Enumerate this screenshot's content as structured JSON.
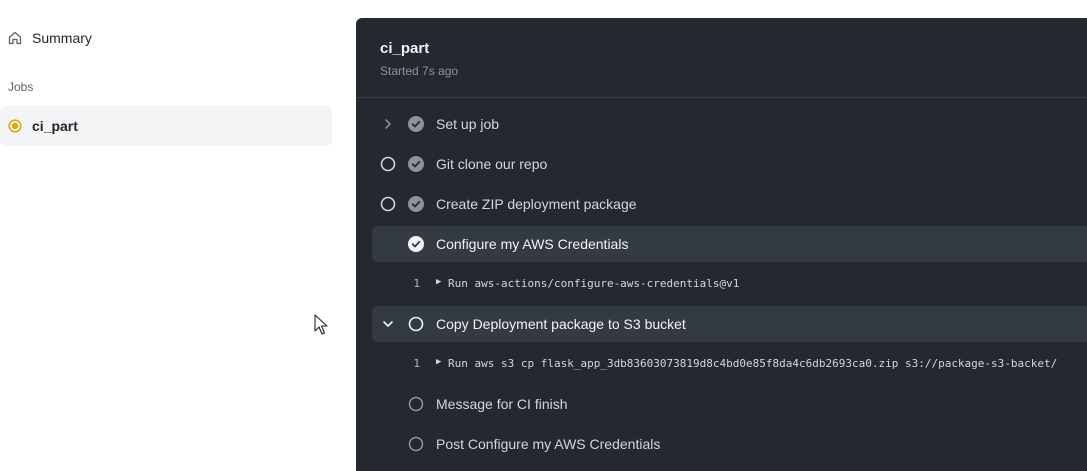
{
  "sidebar": {
    "summary_label": "Summary",
    "jobs_heading": "Jobs",
    "job": {
      "name": "ci_part",
      "status": "in_progress"
    }
  },
  "panel": {
    "job_title": "ci_part",
    "started": "Started 7s ago",
    "steps": [
      {
        "label": "Set up job",
        "status": "success"
      },
      {
        "label": "Git clone our repo",
        "status": "success"
      },
      {
        "label": "Create ZIP deployment package",
        "status": "success"
      },
      {
        "label": "Configure my AWS Credentials",
        "status": "success",
        "expanded": true,
        "log": {
          "line": "1",
          "text": "Run aws-actions/configure-aws-credentials@v1"
        }
      },
      {
        "label": "Copy Deployment package to S3 bucket",
        "status": "in_progress",
        "expanded": true,
        "log": {
          "line": "1",
          "text": "Run aws s3 cp flask_app_3db83603073819d8c4bd0e85f8da4c6db2693ca0.zip  s3://package-s3-backet/"
        }
      },
      {
        "label": "Message for CI finish",
        "status": "pending"
      },
      {
        "label": "Post Configure my AWS Credentials",
        "status": "pending"
      }
    ]
  },
  "colors": {
    "panel_bg": "#24292f",
    "step_highlight": "#343a43",
    "in_progress": "#dbab0a",
    "success_fill": "#8b949e"
  },
  "icons": [
    "home-icon",
    "in-progress-icon",
    "chevron-right-icon",
    "chevron-down-icon",
    "check-circle-icon",
    "pending-circle-icon",
    "spinner-icon",
    "play-triangle-icon",
    "mouse-pointer-icon"
  ]
}
